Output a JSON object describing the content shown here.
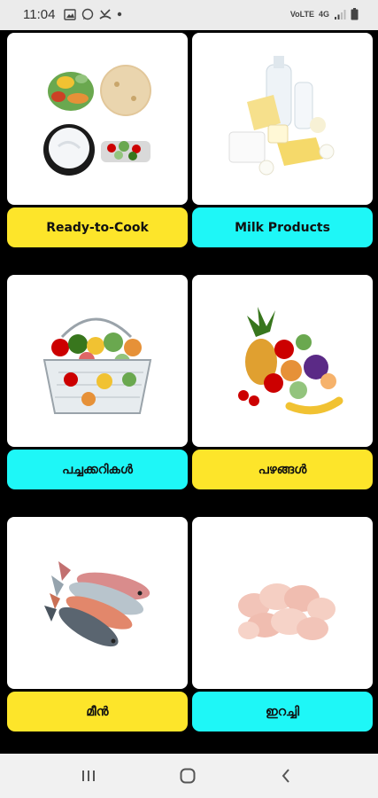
{
  "status_bar": {
    "time": "11:04",
    "network_label": "VoLTE",
    "signal_label": "4G",
    "left_icons": [
      "gallery-icon",
      "whatsapp-icon",
      "missed-call-icon",
      "notification-dot-icon"
    ],
    "right_icons": [
      "volte-icon",
      "4g-icon",
      "signal-icon",
      "battery-icon"
    ]
  },
  "categories": [
    {
      "label": "Ready-to-Cook",
      "color": "#fde52a",
      "image": "ready-to-cook-image"
    },
    {
      "label": "Milk Products",
      "color": "#1ef7f7",
      "image": "milk-products-image"
    },
    {
      "label": "പച്ചക്കറികൾ",
      "color": "#1ef7f7",
      "image": "vegetable-basket-image"
    },
    {
      "label": "പഴങ്ങൾ",
      "color": "#fde52a",
      "image": "fruits-image"
    },
    {
      "label": "മീൻ",
      "color": "#fde52a",
      "image": "fish-image"
    },
    {
      "label": "ഇറച്ചി",
      "color": "#1ef7f7",
      "image": "chicken-meat-image"
    }
  ],
  "nav_bar": {
    "buttons": [
      "recent-apps-icon",
      "home-icon",
      "back-icon"
    ]
  }
}
